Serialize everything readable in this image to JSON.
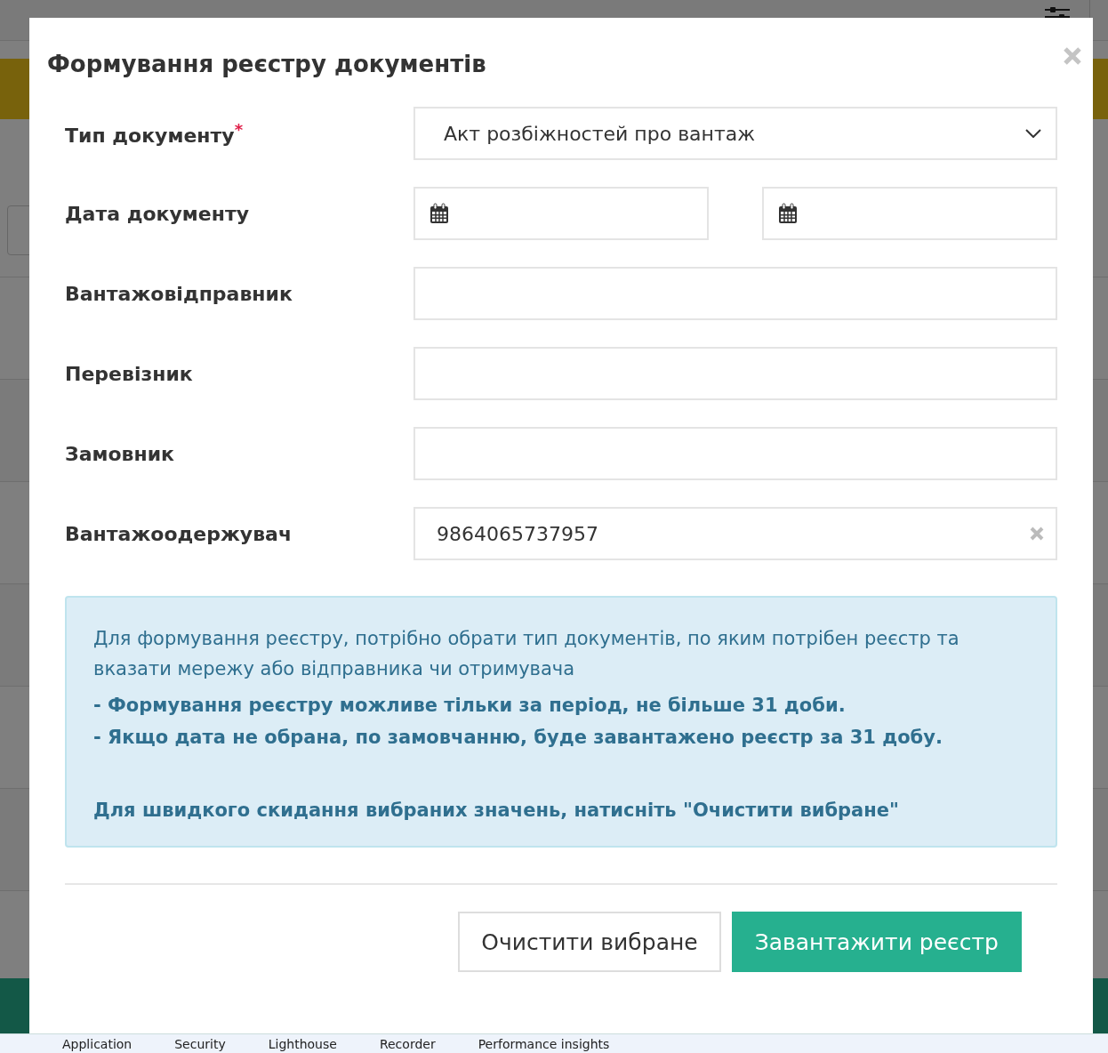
{
  "background": {
    "devtools_tabs": [
      "Application",
      "Security",
      "Lighthouse",
      "Recorder",
      "Performance insights"
    ]
  },
  "modal": {
    "title": "Формування реєстру документів",
    "fields": [
      {
        "label": "Тип документу",
        "required_mark": "*",
        "kind": "select",
        "value": "Акт розбіжностей про вантаж"
      },
      {
        "label": "Дата документу",
        "kind": "date_range"
      },
      {
        "label": "Вантажовідправник",
        "kind": "text"
      },
      {
        "label": "Перевізник",
        "kind": "text"
      },
      {
        "label": "Замовник",
        "kind": "text"
      },
      {
        "label": "Вантажоодержувач",
        "kind": "text",
        "value": "9864065737957"
      }
    ],
    "info": {
      "text": "Для формування реєстру, потрібно обрати тип документів, по яким потрібен реєстр та вказати мережу або відправника чи отримувача",
      "notes": [
        "- Формування реєстру можливе тільки за період, не більше 31 доби.",
        "- Якщо дата не обрана, по замовчанню, буде завантажено реєстр за 31 добу."
      ],
      "hint": "Для швидкого скидання вибраних значень, натисніть \"Очистити вибране\""
    },
    "buttons": [
      {
        "label": "Очистити вибране",
        "kind": "default"
      },
      {
        "label": "Завантажити реєстр",
        "kind": "primary"
      }
    ]
  }
}
